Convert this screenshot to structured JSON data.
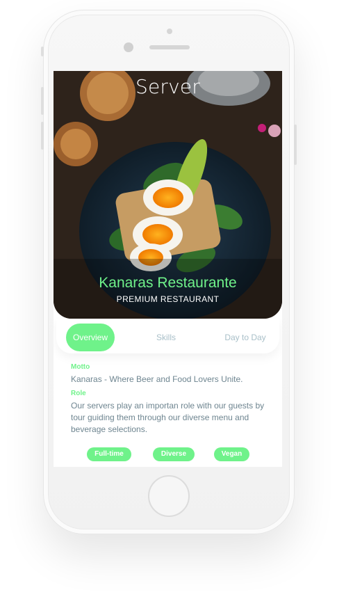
{
  "colors": {
    "accent": "#6ff28a",
    "muted_text": "#6e8590",
    "tab_inactive": "#a8bfc8"
  },
  "hero": {
    "title": "Server",
    "restaurant_name": "Kanaras Restaurante",
    "restaurant_type": "PREMIUM RESTAURANT",
    "image_icon": "food-photo"
  },
  "tabs": [
    {
      "label": "Overview",
      "active": true
    },
    {
      "label": "Skills",
      "active": false
    },
    {
      "label": "Day to Day",
      "active": false
    }
  ],
  "overview": {
    "motto_label": "Motto",
    "motto_text": "Kanaras - Where Beer and Food Lovers Unite.",
    "role_label": "Role",
    "role_text": "Our servers play an importan role with our guests by tour guiding them through our diverse menu and beverage selections."
  },
  "tags": [
    "Full-time",
    "Diverse",
    "Vegan"
  ]
}
